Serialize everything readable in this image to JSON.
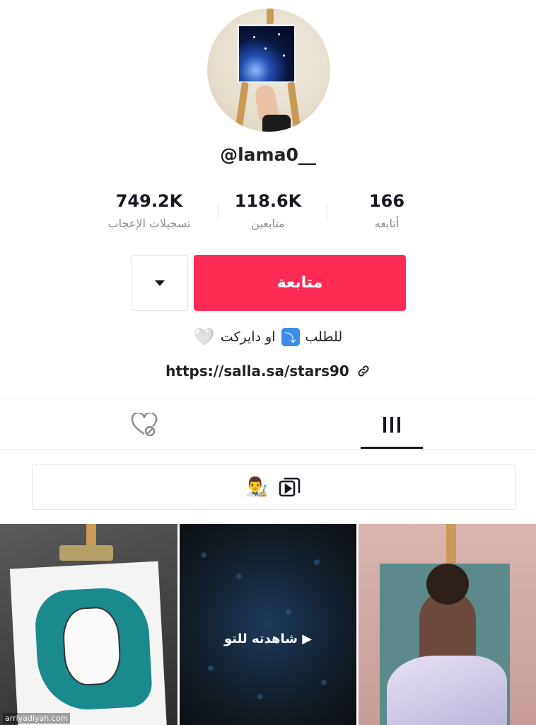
{
  "profile": {
    "username": "@lama0__",
    "avatar_alt": "avatar"
  },
  "stats": [
    {
      "value": "749.2K",
      "label": "تسجيلات الإعجاب"
    },
    {
      "value": "118.6K",
      "label": "متابعين"
    },
    {
      "value": "166",
      "label": "أتابعه"
    }
  ],
  "actions": {
    "follow_label": "متابعة",
    "dropdown_icon": "caret-down-icon"
  },
  "bio": {
    "text_prefix": "للطلب",
    "emoji_label": "⤵",
    "text_suffix": "او دايركت",
    "heart": "🤍"
  },
  "link": {
    "url": "https://salla.sa/stars90",
    "icon": "link-icon"
  },
  "tabs": {
    "videos_icon": "grid-icon",
    "liked_icon": "liked-hidden-icon"
  },
  "playlist": {
    "emoji": "👨‍🎨",
    "icon": "playlist-icon"
  },
  "videos": [
    {
      "overlay": ""
    },
    {
      "overlay": "▶ شاهدته للتو"
    },
    {
      "overlay": ""
    }
  ],
  "watermark": "arriyadiyah.com",
  "colors": {
    "follow_button": "#fe2c55",
    "text_primary": "#161823",
    "text_secondary": "#8a8b91"
  }
}
